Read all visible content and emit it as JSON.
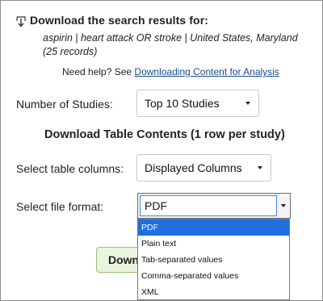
{
  "header": {
    "title": "Download the search results for:",
    "icon": "download-icon"
  },
  "query": "aspirin | heart attack OR stroke | United States, Maryland (25 records)",
  "help": {
    "prefix": "Need help? See ",
    "link_text": "Downloading Content for Analysis"
  },
  "studies": {
    "label": "Number of Studies:",
    "value": "Top 10 Studies"
  },
  "section_title": "Download Table Contents (1 row per study)",
  "columns": {
    "label": "Select table columns:",
    "value": "Displayed Columns"
  },
  "format": {
    "label": "Select file format:",
    "value": "PDF",
    "options": [
      "PDF",
      "Plain text",
      "Tab-separated values",
      "Comma-separated values",
      "XML"
    ],
    "selected_index": 0
  },
  "download_button": {
    "label": "Download"
  },
  "colors": {
    "link": "#1a4c8e",
    "selected_option": "#1f6fe0",
    "button_bg": "#e9f4dc"
  }
}
